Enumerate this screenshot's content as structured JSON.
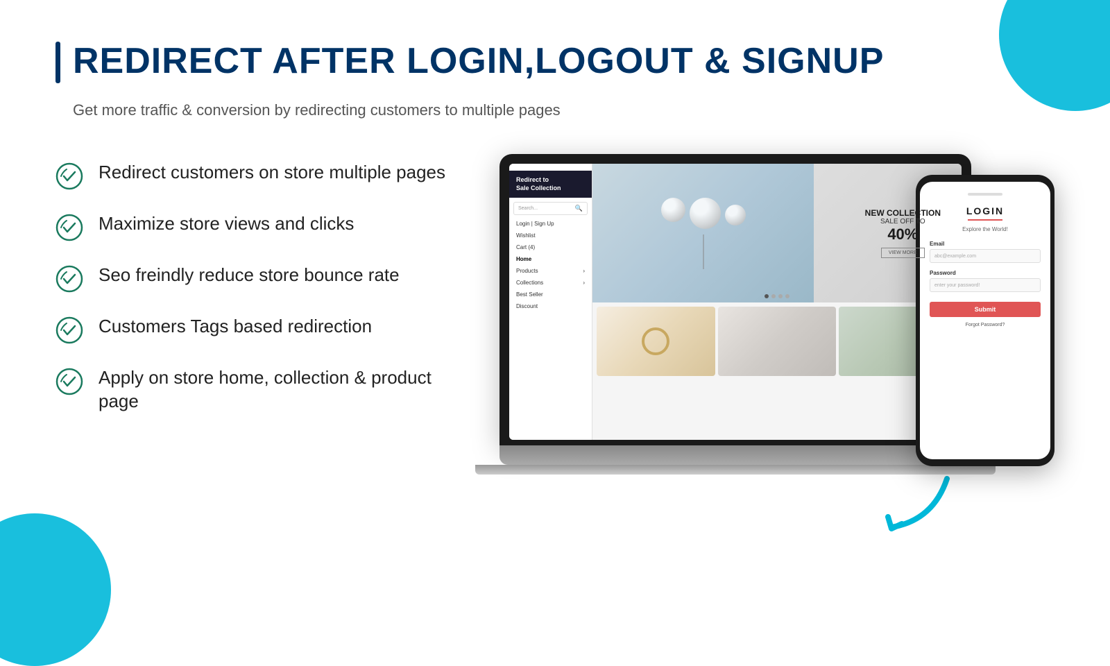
{
  "decorations": {
    "top_right_circle_color": "#00b8d9",
    "bottom_left_circle_color": "#00b8d9"
  },
  "header": {
    "title": "REDIRECT AFTER LOGIN,LOGOUT & SIGNUP",
    "subtitle": "Get more traffic & conversion by redirecting customers to multiple pages"
  },
  "features": [
    {
      "id": 1,
      "text": "Redirect customers on store multiple pages"
    },
    {
      "id": 2,
      "text": "Maximize store views and clicks"
    },
    {
      "id": 3,
      "text": "Seo freindly reduce store bounce rate"
    },
    {
      "id": 4,
      "text": "Customers Tags based redirection"
    },
    {
      "id": 5,
      "text": "Apply on store home, collection & product page"
    }
  ],
  "laptop_screen": {
    "redirect_banner": "Redirect to\nSale Collection",
    "search_placeholder": "Search...",
    "nav_items": [
      "Login | Sign Up",
      "Wishlist",
      "Cart (4)",
      "Home",
      "Products",
      "Collections",
      "Best Seller",
      "Discount"
    ],
    "hero": {
      "new_collection": "NEW COLLECTION",
      "sale_off": "SALE OFF TO",
      "percent": "40%",
      "view_more": "VIEW MORE"
    }
  },
  "phone_screen": {
    "title": "LOGIN",
    "explore": "Explore the World!",
    "email_label": "Email",
    "email_placeholder": "abc@example.com",
    "password_label": "Password",
    "password_placeholder": "enter your password!",
    "submit": "Submit",
    "forgot": "Forgot Password?"
  }
}
